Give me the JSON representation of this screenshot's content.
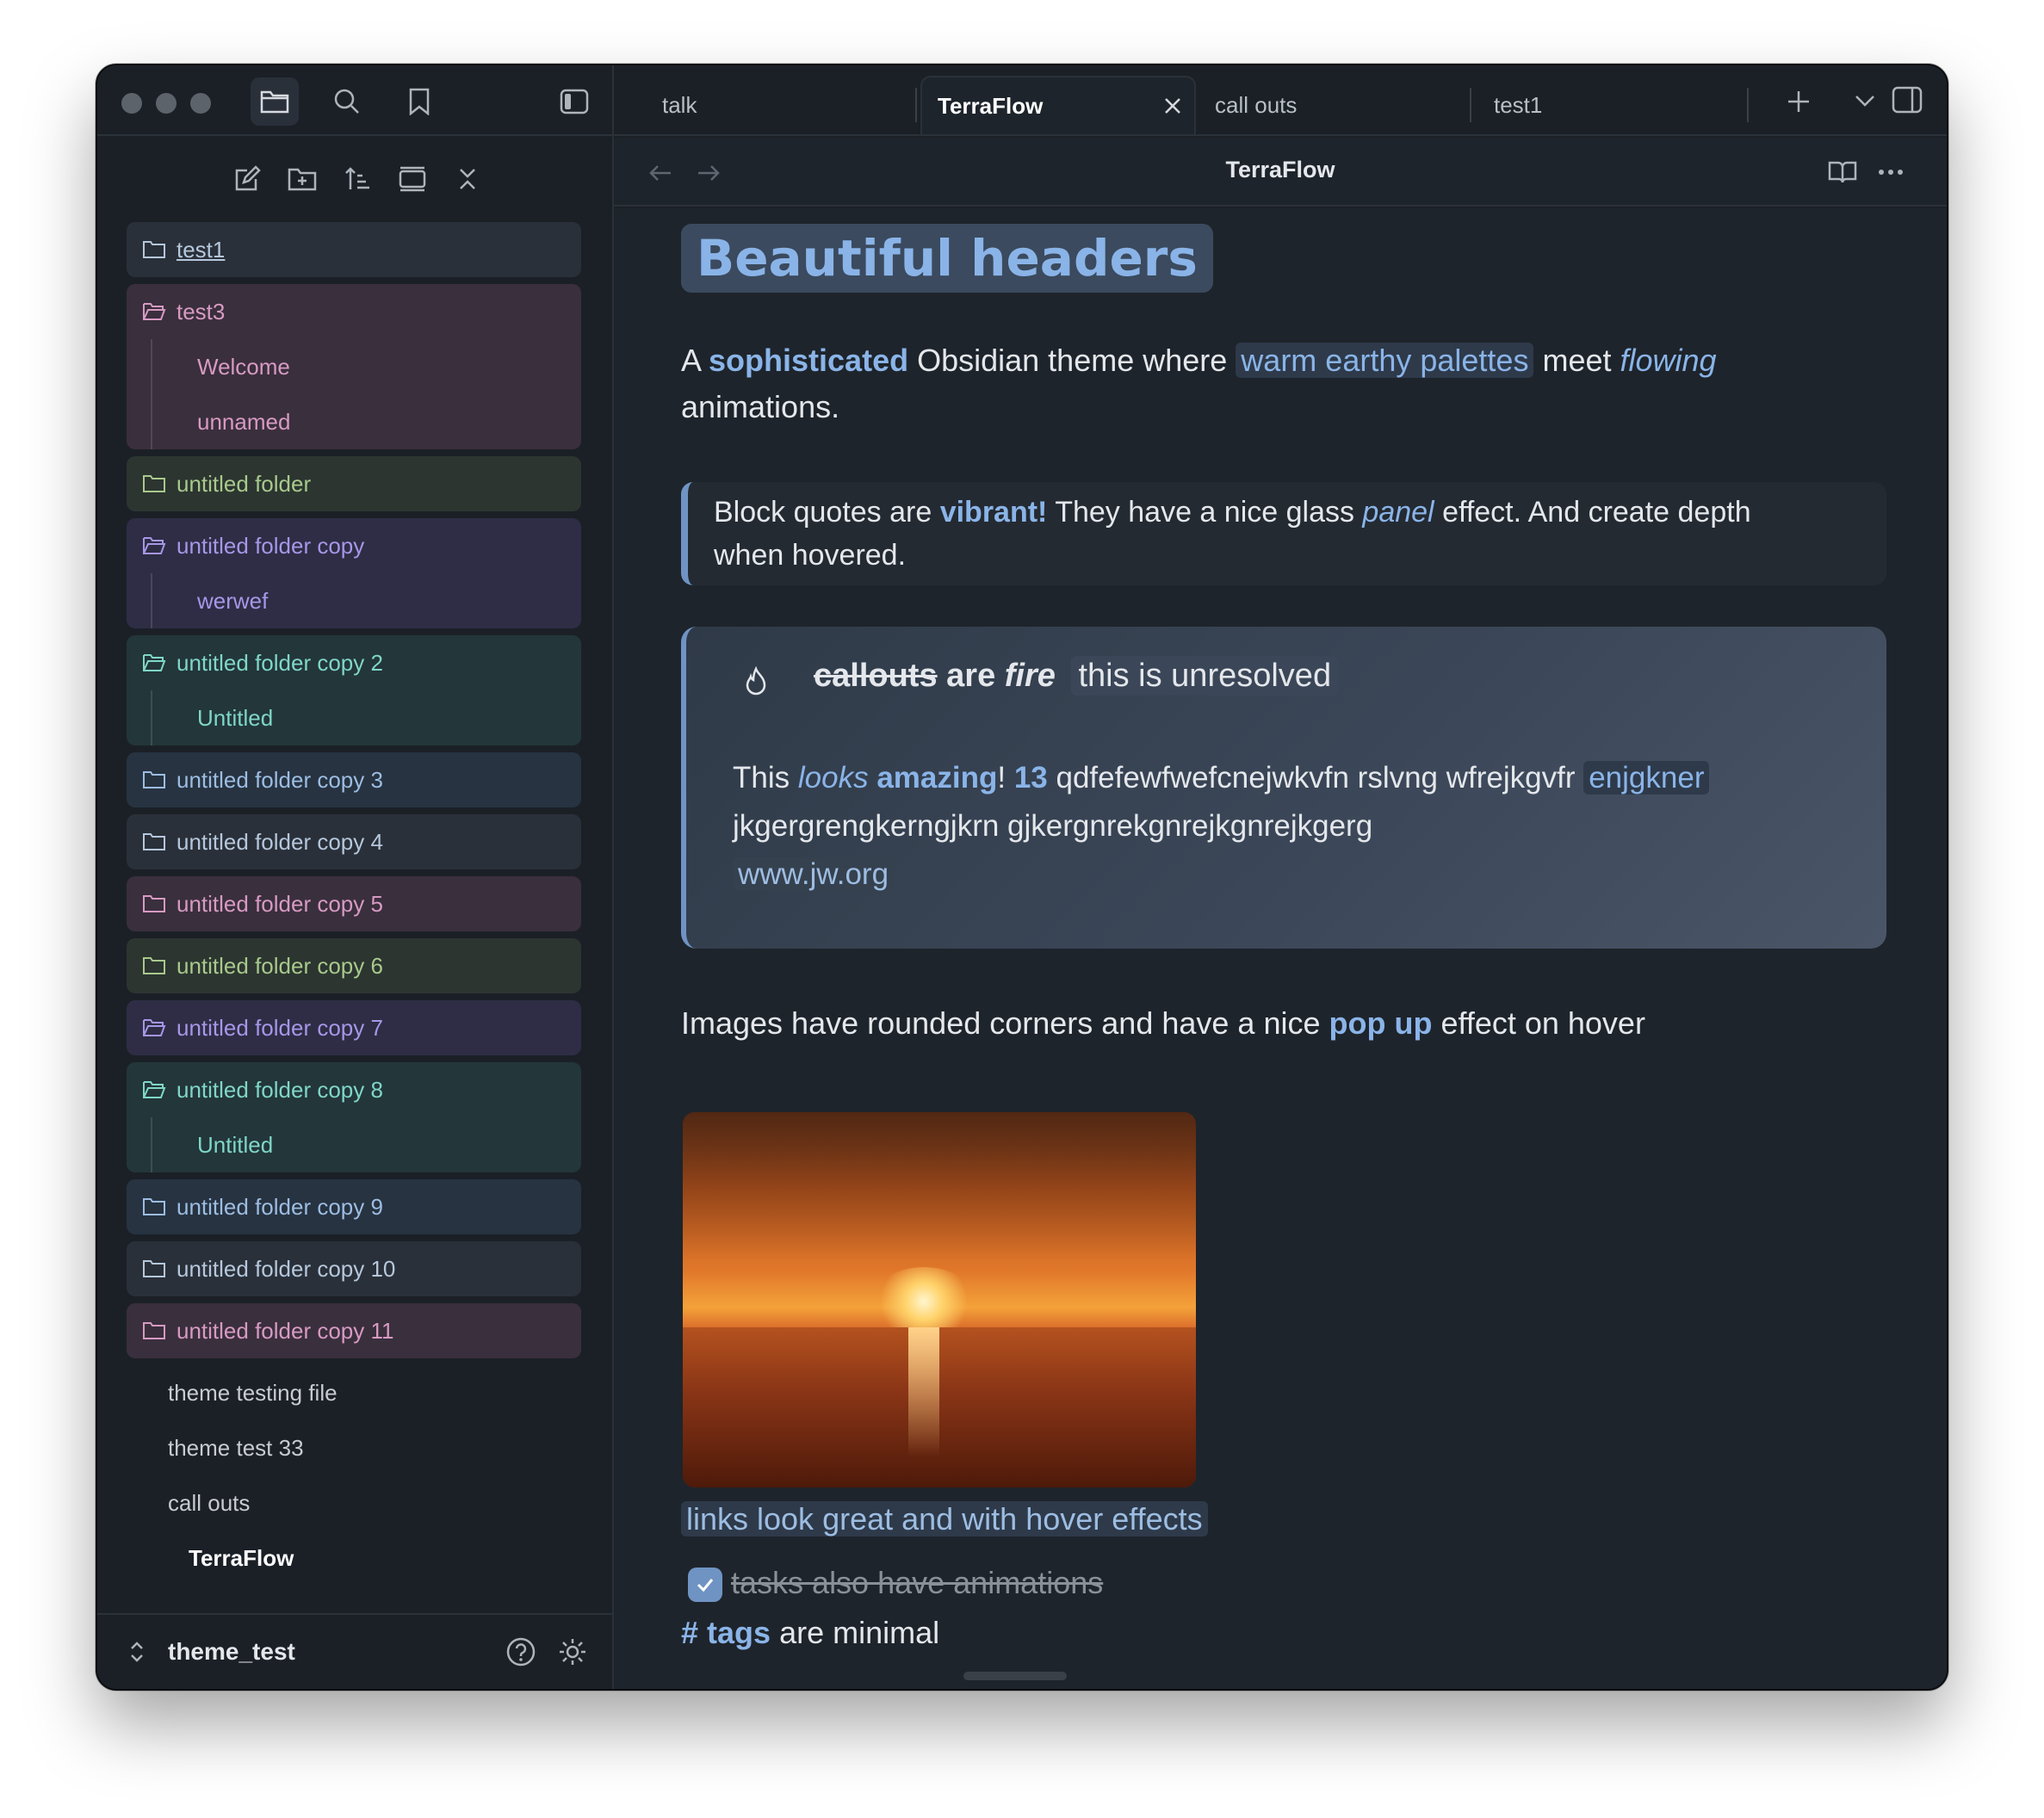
{
  "colors": {
    "accent": "#8ab4e8",
    "bg": "#1e242b",
    "sidebar": "#1b2027"
  },
  "sidebar": {
    "top_icons": [
      "folder-icon",
      "search-icon",
      "bookmark-icon",
      "sidebar-toggle-icon"
    ],
    "tools": [
      "new-note-icon",
      "new-folder-icon",
      "sort-icon",
      "collapse-icon",
      "close-icon"
    ],
    "folders": [
      {
        "label": "test1",
        "children": []
      },
      {
        "label": "test3",
        "children": [
          "Welcome",
          "unnamed"
        ]
      },
      {
        "label": "untitled folder",
        "children": []
      },
      {
        "label": "untitled folder copy",
        "children": [
          "werwef"
        ]
      },
      {
        "label": "untitled folder copy 2",
        "children": [
          "Untitled"
        ]
      },
      {
        "label": "untitled folder copy 3",
        "children": []
      },
      {
        "label": "untitled folder copy 4",
        "children": []
      },
      {
        "label": "untitled folder copy 5",
        "children": []
      },
      {
        "label": "untitled folder copy 6",
        "children": []
      },
      {
        "label": "untitled folder copy 7",
        "children": []
      },
      {
        "label": "untitled folder copy 8",
        "children": [
          "Untitled"
        ]
      },
      {
        "label": "untitled folder copy 9",
        "children": []
      },
      {
        "label": "untitled folder copy 10",
        "children": []
      },
      {
        "label": "untitled folder copy 11",
        "children": []
      }
    ],
    "files": [
      "theme testing file",
      "theme test 33",
      "call outs",
      "TerraFlow"
    ],
    "vault_name": "theme_test"
  },
  "tabs": [
    {
      "label": "talk"
    },
    {
      "label": "TerraFlow"
    },
    {
      "label": "call outs"
    },
    {
      "label": "test1"
    }
  ],
  "navbar": {
    "title": "TerraFlow"
  },
  "content": {
    "header": "Beautiful headers",
    "intro": {
      "a": "A ",
      "sophisticated": "sophisticated",
      "mid": " Obsidian theme where ",
      "highlight": "warm earthy palettes",
      "meet": " meet ",
      "flowing": "flowing",
      "end": "animations."
    },
    "quote": {
      "p1": "Block quotes are ",
      "vibrant": "vibrant!",
      "p2": " They have a nice glass ",
      "panel": "panel",
      "p3": " effect. And create depth",
      "p4": "when hovered."
    },
    "callout": {
      "strike": "callouts",
      "are": " are ",
      "fire": "fire",
      "unresolved": "this is unresolved",
      "b1": "This ",
      "looks": "looks",
      "amazing": "amazing",
      "excl": "!",
      "num": "13",
      "b2": " qdfefewfwefcnejwkvfn rslvng wfrejkgvfr ",
      "enjgkner": "enjgkner",
      "b3": "jkgergrengkerngjkrn gjkergnrekgnrejkgnrejkgerg",
      "link": "www.jw.org"
    },
    "images": {
      "p1": "Images have rounded corners and have a nice ",
      "popup": "pop up",
      "p2": " effect on hover"
    },
    "links": "links look great and with hover effects",
    "task": "tasks also have animations",
    "tags": {
      "hash": "#",
      "tag": "tags",
      "rest": " are minimal"
    }
  }
}
